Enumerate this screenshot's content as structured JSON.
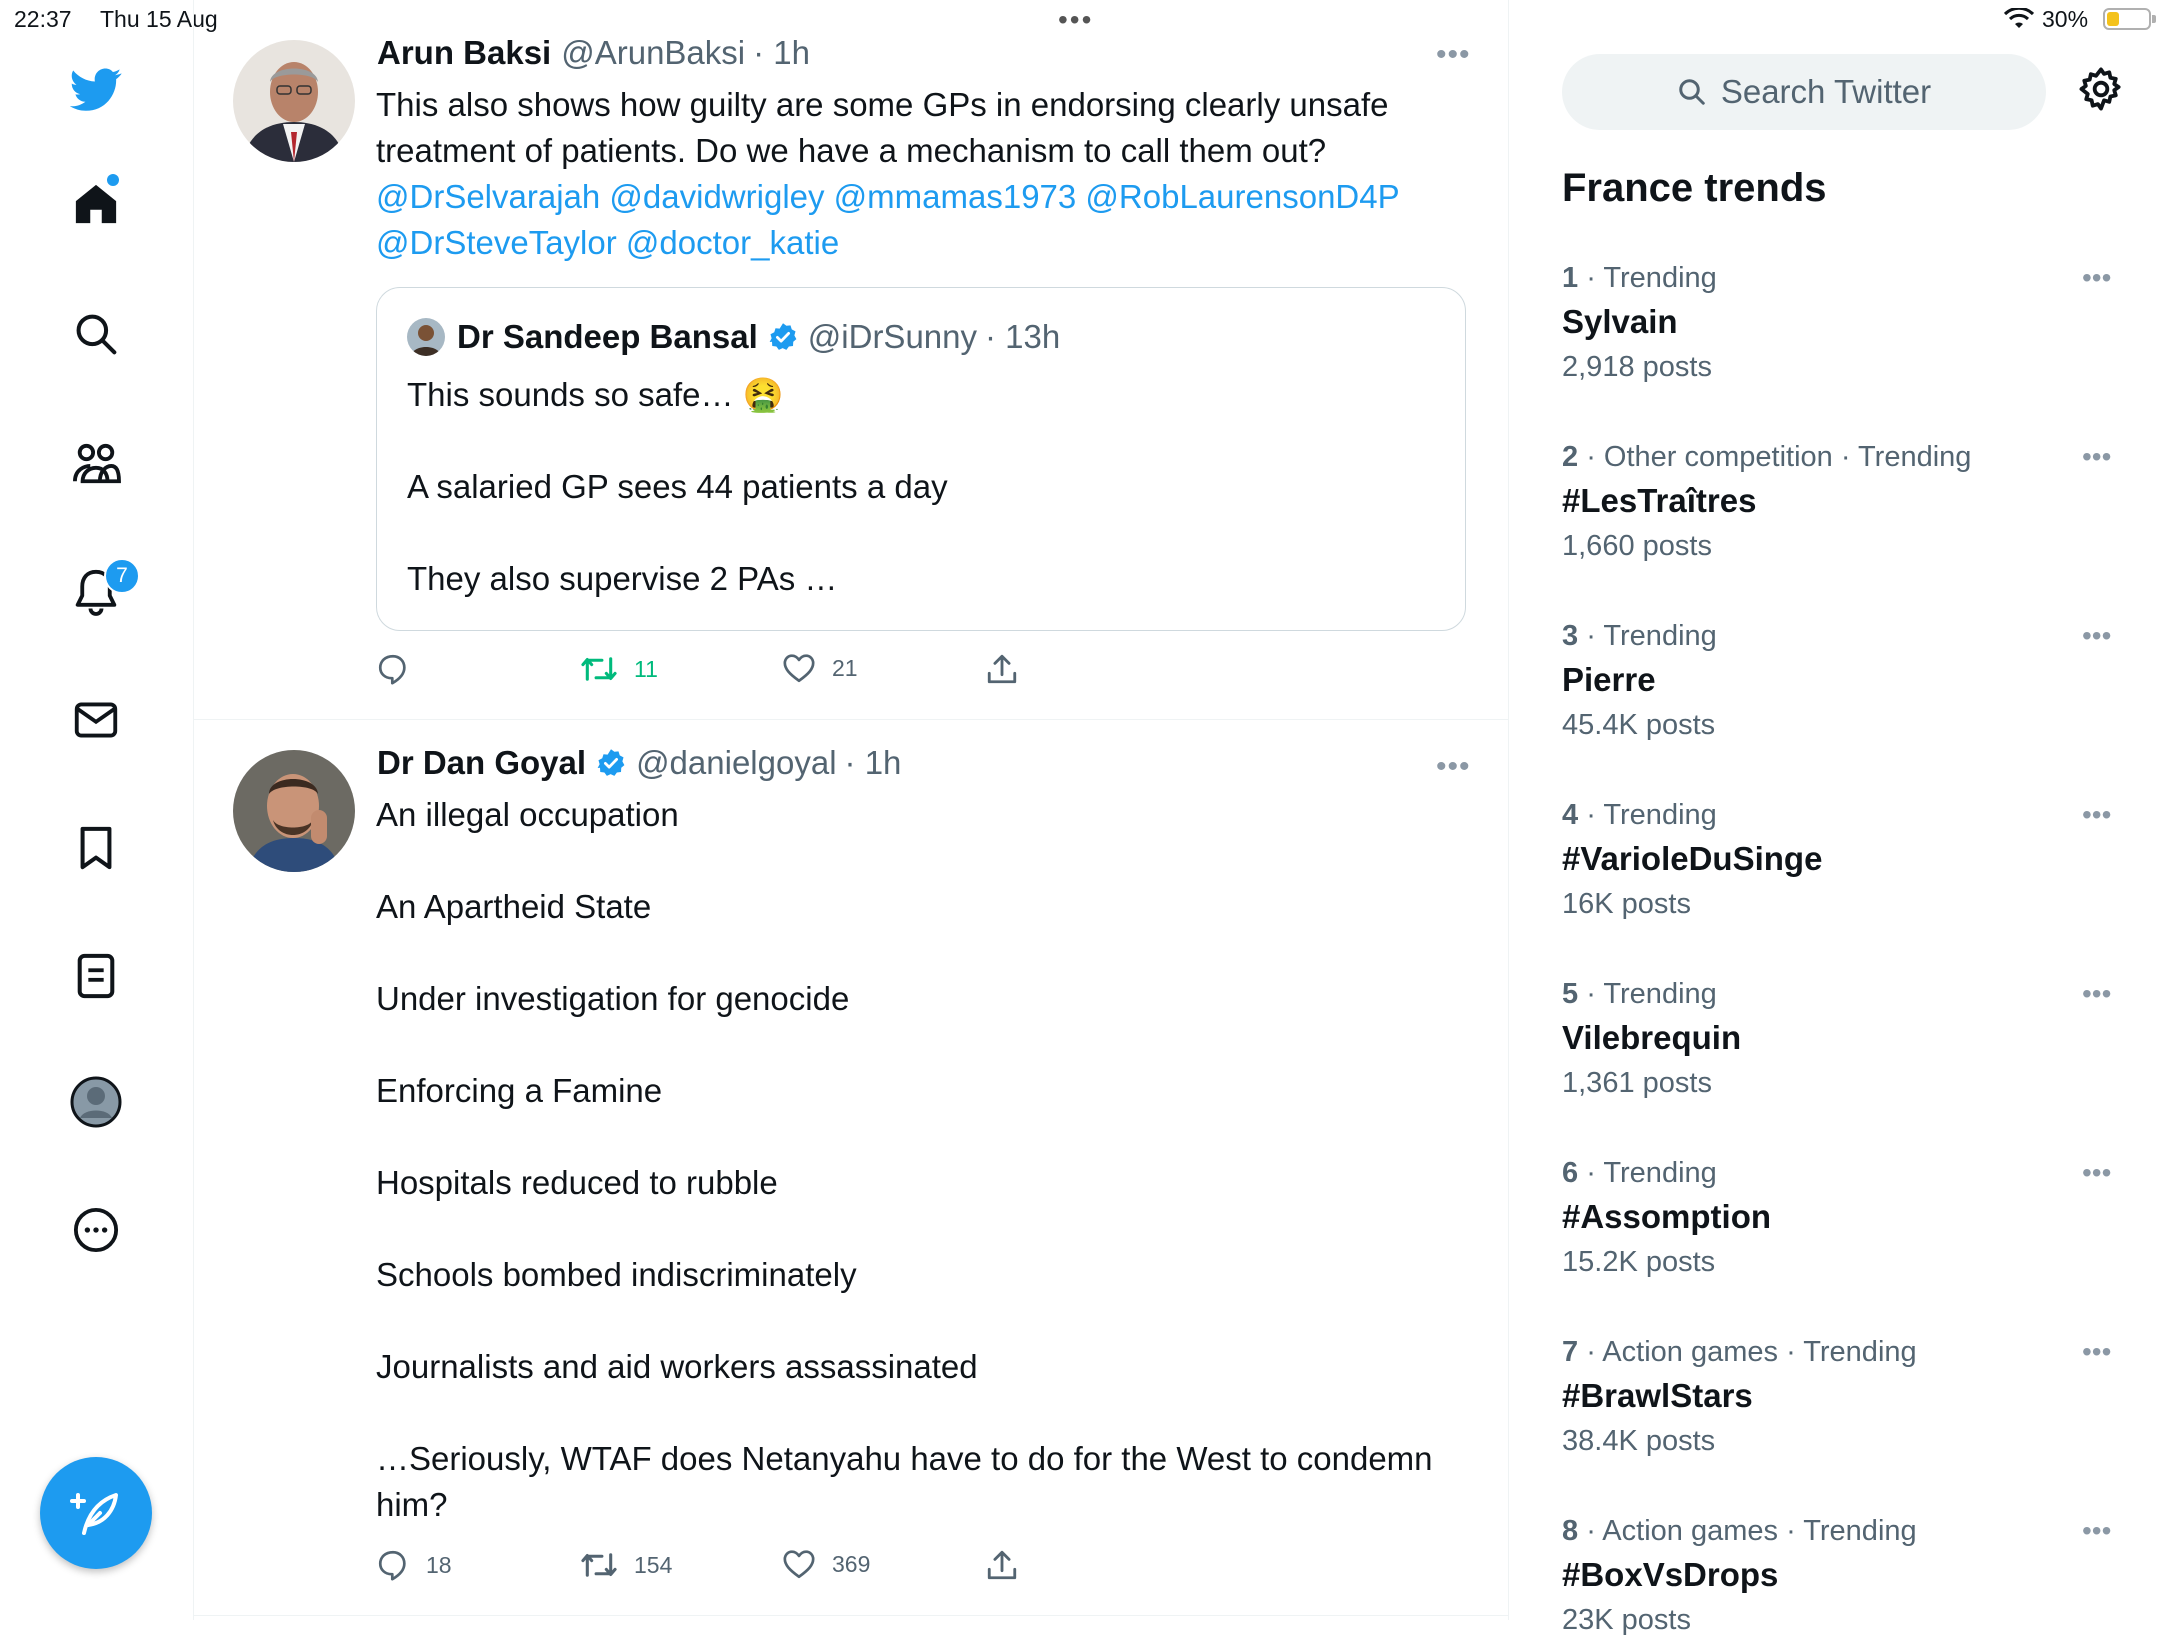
{
  "status_bar": {
    "time": "22:37",
    "date": "Thu 15 Aug",
    "battery": "30%",
    "battery_level": 0.3
  },
  "nav": {
    "notifications_badge": "7",
    "items": [
      "home-icon",
      "search-icon",
      "communities-icon",
      "notifications-icon",
      "messages-icon",
      "bookmarks-icon",
      "lists-icon",
      "profile-icon",
      "more-icon"
    ]
  },
  "tweets": [
    {
      "name": "Arun Baksi",
      "handle": "@ArunBaksi",
      "time": "· 1h",
      "text_lines": [
        "This also shows how guilty are some GPs in endorsing clearly unsafe",
        "treatment of patients. Do we have a mechanism to call them out?"
      ],
      "mentions_line1": "@DrSelvarajah @davidwrigley @mmamas1973 @RobLaurensonD4P",
      "mentions_line2": "@DrSteveTaylor @doctor_katie",
      "quote": {
        "name": "Dr Sandeep Bansal",
        "handle": "@iDrSunny",
        "time": "· 13h",
        "line1": "This sounds so safe…",
        "emoji": "🤮",
        "line2": "A salaried GP sees 44 patients a day",
        "line3": "They also supervise 2 PAs …"
      },
      "replies": "",
      "retweets": "11",
      "likes": "21"
    },
    {
      "name": "Dr Dan Goyal",
      "handle": "@danielgoyal",
      "time": "· 1h",
      "lines": [
        "An illegal occupation",
        "An Apartheid State",
        "Under investigation for genocide",
        "Enforcing a Famine",
        "Hospitals reduced to rubble",
        "Schools bombed indiscriminately",
        "Journalists and aid workers assassinated",
        "…Seriously, WTAF does Netanyahu have to do for the West to condemn",
        "him?"
      ],
      "replies": "18",
      "retweets": "154",
      "likes": "369"
    }
  ],
  "sidebar": {
    "search_placeholder": "Search Twitter",
    "title": "France trends",
    "trends": [
      {
        "rank": "1",
        "category": " · Trending",
        "name": "Sylvain",
        "posts": "2,918 posts"
      },
      {
        "rank": "2",
        "category": " · Other competition · Trending",
        "name": "#LesTraîtres",
        "posts": "1,660 posts"
      },
      {
        "rank": "3",
        "category": " · Trending",
        "name": "Pierre",
        "posts": "45.4K posts"
      },
      {
        "rank": "4",
        "category": " · Trending",
        "name": "#VarioleDuSinge",
        "posts": "16K posts"
      },
      {
        "rank": "5",
        "category": " · Trending",
        "name": "Vilebrequin",
        "posts": "1,361 posts"
      },
      {
        "rank": "6",
        "category": " · Trending",
        "name": "#Assomption",
        "posts": "15.2K posts"
      },
      {
        "rank": "7",
        "category": " · Action games · Trending",
        "name": "#BrawlStars",
        "posts": "38.4K posts"
      },
      {
        "rank": "8",
        "category": " · Action games · Trending",
        "name": "#BoxVsDrops",
        "posts": "23K posts"
      }
    ]
  },
  "colors": {
    "accent": "#1d9bf0",
    "retweet_active": "#00ba7c",
    "text": "#0f1419",
    "secondary": "#536471"
  }
}
